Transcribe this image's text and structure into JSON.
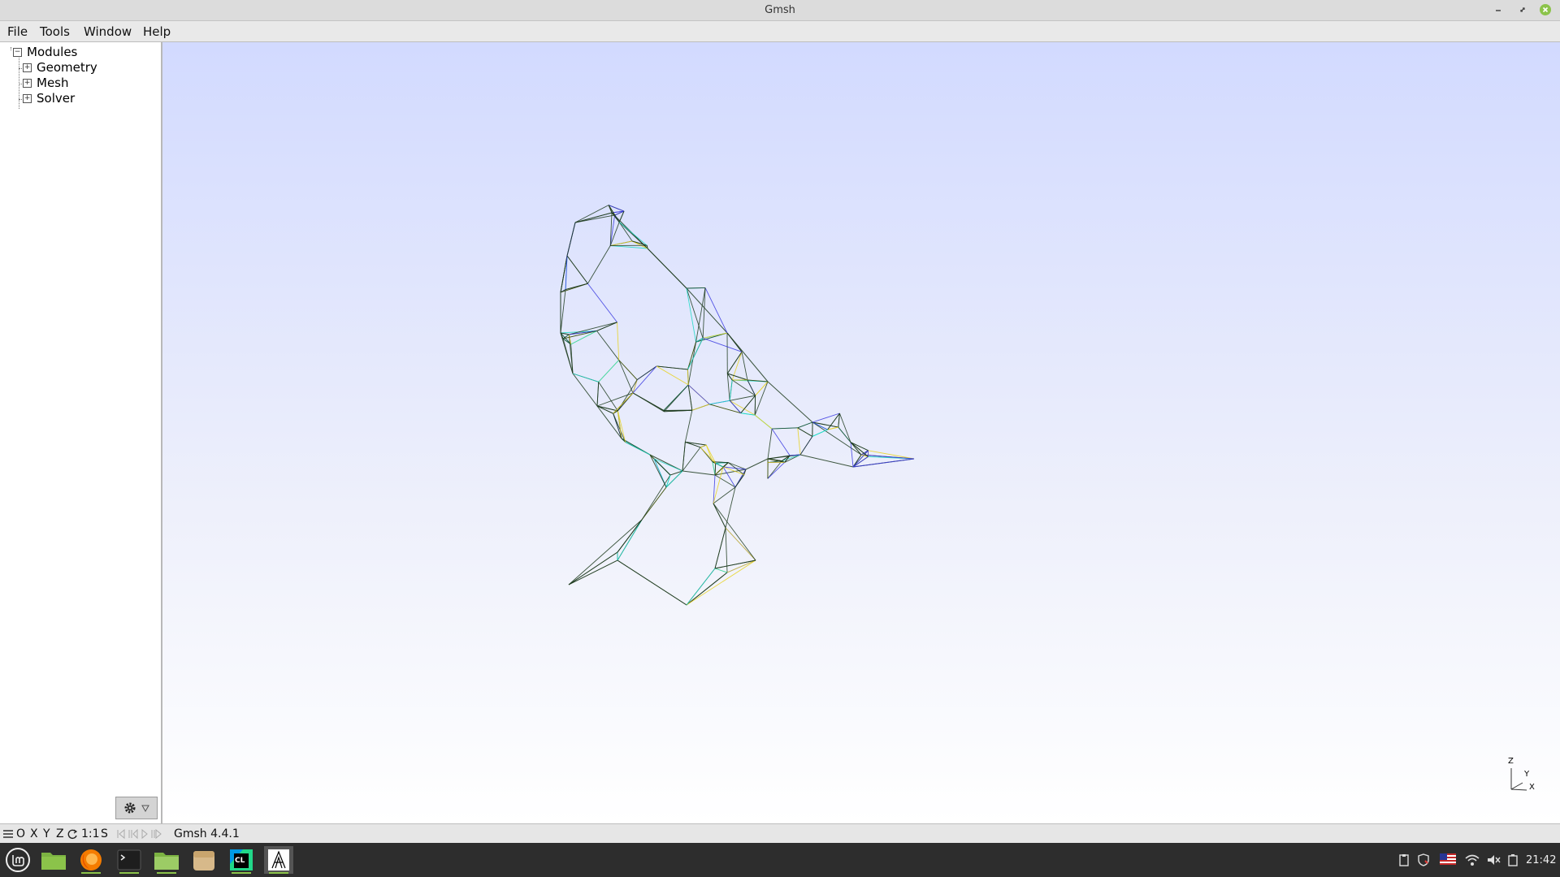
{
  "window": {
    "title": "Gmsh"
  },
  "menu": [
    "File",
    "Tools",
    "Window",
    "Help"
  ],
  "tree": {
    "root": "Modules",
    "children": [
      "Geometry",
      "Mesh",
      "Solver"
    ]
  },
  "axes_labels": {
    "z": "Z",
    "y": "Y",
    "x": "X"
  },
  "statusbar": {
    "view_buttons": [
      "O",
      "X",
      "Y",
      "Z"
    ],
    "scale_button": "1:1",
    "s_button": "S",
    "message": "Gmsh 4.4.1"
  },
  "taskbar": {
    "apps": [
      "linux-mint-menu",
      "files",
      "firefox",
      "terminal",
      "folder",
      "archive",
      "clion",
      "gmsh"
    ],
    "clock": "21:42"
  },
  "colors": {
    "viewport_top": "#d2daff",
    "viewport_bottom": "#ffffff",
    "mesh_dark": "#1c3a1c",
    "mesh_cyan": "#19d9c4",
    "mesh_yellow": "#e8d21c",
    "mesh_blue": "#3a3ae0"
  }
}
